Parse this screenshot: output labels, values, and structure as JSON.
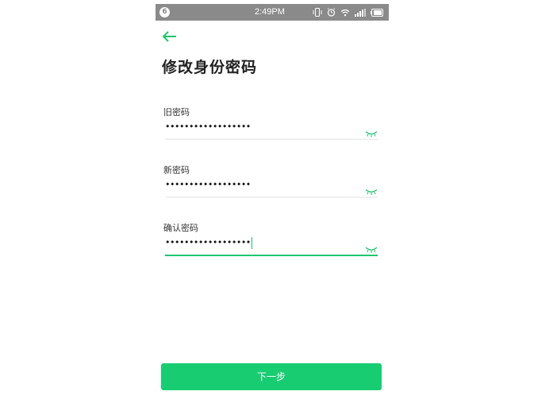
{
  "status_bar": {
    "badge": "6",
    "time": "2:49PM",
    "icons": [
      "vibrate-icon",
      "alarm-icon",
      "wifi-icon",
      "signal-icon",
      "battery-icon"
    ]
  },
  "header": {
    "back_icon": "arrow-left-icon",
    "title": "修改身份密码"
  },
  "form": {
    "fields": [
      {
        "label": "旧密码",
        "value": "••••••••••••••••••",
        "active": false,
        "toggle_icon": "eye-closed-icon"
      },
      {
        "label": "新密码",
        "value": "••••••••••••••••••",
        "active": false,
        "toggle_icon": "eye-closed-icon"
      },
      {
        "label": "确认密码",
        "value": "••••••••••••••••••",
        "active": true,
        "toggle_icon": "eye-closed-icon"
      }
    ]
  },
  "footer": {
    "next_label": "下一步"
  },
  "colors": {
    "accent": "#1fc56f",
    "button": "#18cc72",
    "status_bar": "#8a8a8a",
    "title": "#222222"
  }
}
